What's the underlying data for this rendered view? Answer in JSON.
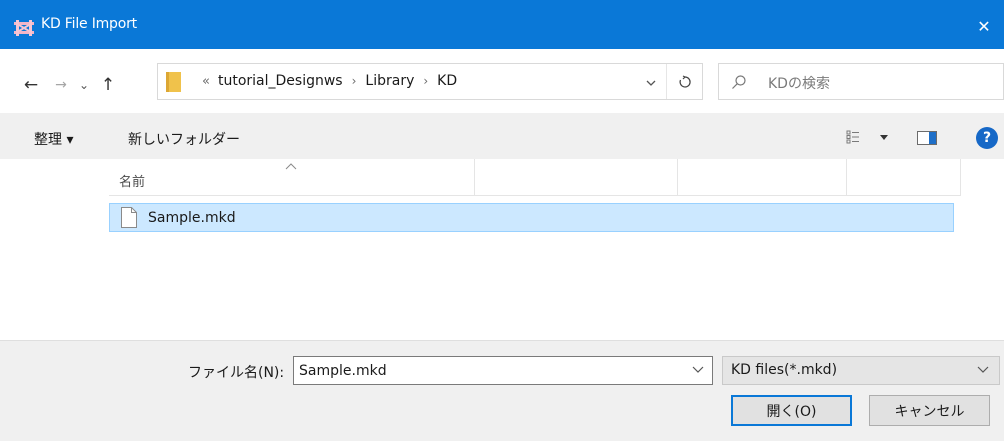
{
  "window": {
    "title": "KD File Import",
    "close_glyph": "✕"
  },
  "nav": {
    "back_glyph": "←",
    "forward_glyph": "→",
    "recent_glyph": "⌄",
    "up_glyph": "↑"
  },
  "address": {
    "lead_glyph": "«",
    "crumbs": [
      "tutorial_Designws",
      "Library",
      "KD"
    ],
    "separator": "›"
  },
  "search": {
    "placeholder": "KDの検索"
  },
  "toolbar": {
    "organize_label": "整理 ▾",
    "new_folder_label": "新しいフォルダー"
  },
  "columns": {
    "name_label": "名前"
  },
  "files": [
    {
      "name": "Sample.mkd",
      "selected": true
    }
  ],
  "footer": {
    "filename_label": "ファイル名(N):",
    "filename_value": "Sample.mkd",
    "filetype_value": "KD files(*.mkd)",
    "open_label": "開く(O)",
    "cancel_label": "キャンセル"
  },
  "colors": {
    "titlebar": "#0a78d7",
    "selection": "#cce8ff",
    "chrome": "#f0f0f0"
  }
}
